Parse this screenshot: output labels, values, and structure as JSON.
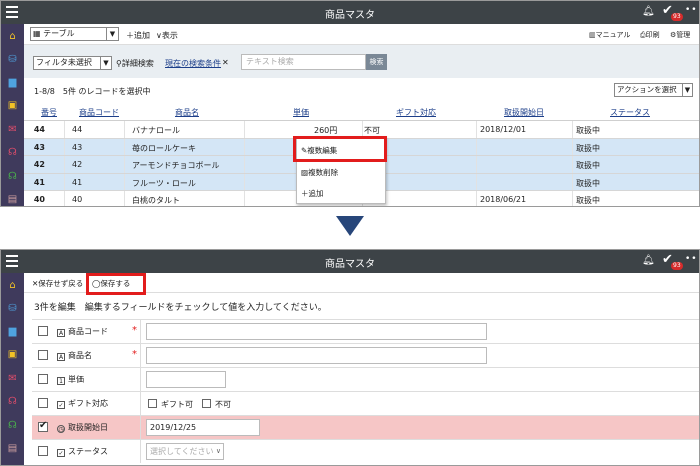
{
  "app_title": "商品マスタ",
  "notification_badge": "93",
  "list_view": {
    "toolbar": {
      "view_select": "テーブル",
      "add_label": "追加",
      "display_label": "表示",
      "manual_label": "マニュアル",
      "print_label": "印刷",
      "admin_label": "管理"
    },
    "filter": {
      "filter_select": "フィルタ未選択",
      "advanced_search": "詳細検索",
      "current_condition": "現在の検索条件",
      "search_placeholder": "テキスト検索",
      "search_button": "検索"
    },
    "info": {
      "record_info": "1-8/8　5件 のレコードを選択中",
      "action_select": "アクションを選択"
    },
    "table": {
      "headers": [
        "番号",
        "商品コード",
        "商品名",
        "単価",
        "ギフト対応",
        "取扱開始日",
        "ステータス"
      ],
      "rows": [
        {
          "no": "44",
          "code": "44",
          "name": "バナナロール",
          "price": "260円",
          "gift": "不可",
          "start": "2018/12/01",
          "status": "取扱中",
          "selected": false
        },
        {
          "no": "43",
          "code": "43",
          "name": "苺のロールケーキ",
          "price": "",
          "gift": "",
          "start": "",
          "status": "取扱中",
          "selected": true
        },
        {
          "no": "42",
          "code": "42",
          "name": "アーモンドチョコボール",
          "price": "",
          "gift": "",
          "start": "",
          "status": "取扱中",
          "selected": true
        },
        {
          "no": "41",
          "code": "41",
          "name": "フルーツ・ロール",
          "price": "",
          "gift": "",
          "start": "",
          "status": "取扱中",
          "selected": true
        },
        {
          "no": "40",
          "code": "40",
          "name": "白桃のタルト",
          "price": "",
          "gift": "",
          "start": "2018/06/21",
          "status": "取扱中",
          "selected": false
        }
      ]
    },
    "context_menu": {
      "bulk_edit": "複数編集",
      "bulk_delete": "複数削除",
      "add": "追加"
    }
  },
  "edit_view": {
    "toolbar": {
      "back_label": "保存せず戻る",
      "save_label": "保存する"
    },
    "heading": "3件を編集　編集するフィールドをチェックして値を入力してください。",
    "fields": [
      {
        "label": "商品コード",
        "icon": "text-field-icon",
        "required": "*",
        "value": ""
      },
      {
        "label": "商品名",
        "icon": "text-field-icon",
        "required": "*",
        "value": ""
      },
      {
        "label": "単価",
        "icon": "number-field-icon",
        "value": ""
      },
      {
        "label": "ギフト対応",
        "icon": "checkbox-field-icon",
        "option1": "ギフト可",
        "option2": "不可"
      },
      {
        "label": "取扱開始日",
        "icon": "clock-icon",
        "value": "2019/12/25"
      },
      {
        "label": "ステータス",
        "icon": "checkbox-field-icon",
        "placeholder": "選択してください"
      }
    ]
  },
  "colors": {
    "titlebar": "#3d4347",
    "sidebar": "#3f3a5c",
    "selected_row": "#d4e6f6",
    "highlight_row": "#f6c6c6",
    "callout": "#e21c1c",
    "arrow": "#27467a"
  }
}
